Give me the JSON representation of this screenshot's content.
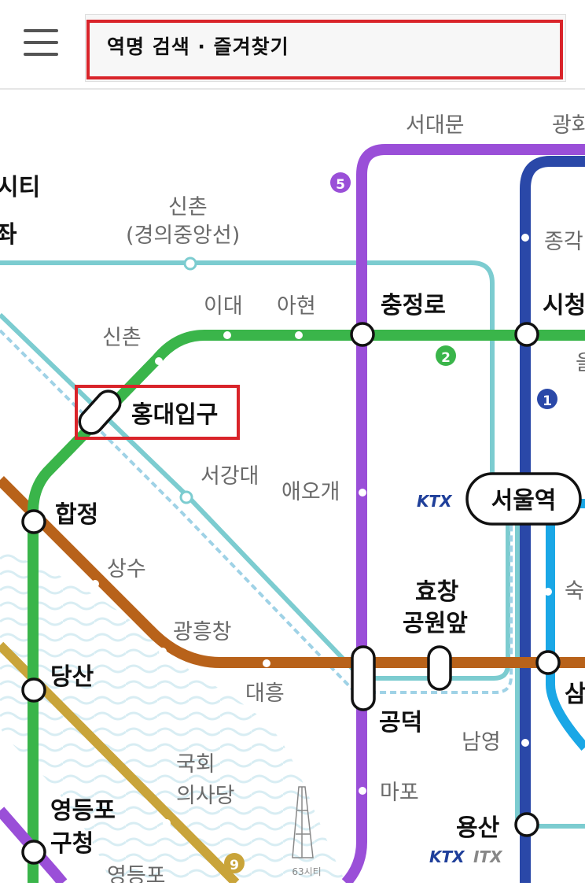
{
  "search": {
    "placeholder": "역명 검색 · 즐겨찾기"
  },
  "line_badges": {
    "line5": "5",
    "line2": "2",
    "line1": "1",
    "line9": "9"
  },
  "stations": {
    "seodaemun": "서대문",
    "gwanghwamun_partial": "광화",
    "city_partial": "시티",
    "jwa_partial": "좌",
    "sinchon_gyeongui_1": "신촌",
    "sinchon_gyeongui_2": "(경의중앙선)",
    "jonggak_partial": "종각",
    "idae": "이대",
    "ahyeon": "아현",
    "chungjeongno": "충정로",
    "cityhall_partial": "시청",
    "euljiro_partial": "을",
    "sinchon": "신촌",
    "hongik": "홍대입구",
    "seogang": "서강대",
    "aeogae": "애오개",
    "seoul": "서울역",
    "hapjeong": "합정",
    "sangsu": "상수",
    "hyochang_1": "효창",
    "hyochang_2": "공원앞",
    "sook_partial": "숙",
    "gwangheungchang": "광흥창",
    "daeheung": "대흥",
    "sam_partial": "삼",
    "dangsan": "당산",
    "gongdeok": "공덕",
    "namyeong": "남영",
    "gukhoe_1": "국회",
    "gukhoe_2": "의사당",
    "mapo": "마포",
    "yongsan": "용산",
    "yeongdeungpo_gu_1": "영등포",
    "yeongdeungpo_gu_2": "구청",
    "yeongdeungpo_partial": "영등포"
  },
  "labels": {
    "ktx1": "KTX",
    "ktx2": "KTX",
    "itx": "ITX",
    "building": "63시티"
  },
  "colors": {
    "line1": "#2a48a8",
    "line2": "#3ab54a",
    "line5": "#9a4fd8",
    "line6": "#b8621a",
    "line9": "#c9a43a",
    "gyeongui": "#7cccd0",
    "line4": "#1aa7e6",
    "highlight": "#d9242a"
  }
}
